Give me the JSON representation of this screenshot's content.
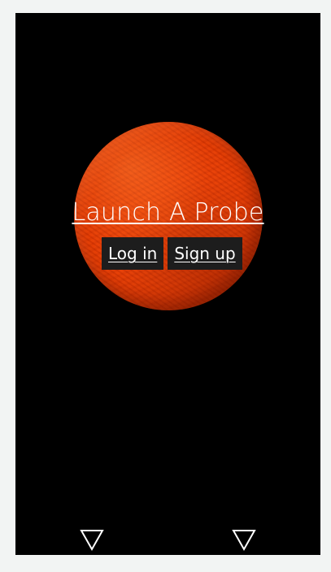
{
  "app": {
    "title": "Launch A Probe"
  },
  "auth": {
    "login_label": "Log in",
    "signup_label": "Sign up"
  },
  "nav": {
    "left_icon": "triangle-down-icon",
    "right_icon": "triangle-down-icon"
  },
  "colors": {
    "background": "#000000",
    "planet": "#e23c06",
    "button_bg": "#1d1d1d",
    "text": "#ffffff"
  }
}
